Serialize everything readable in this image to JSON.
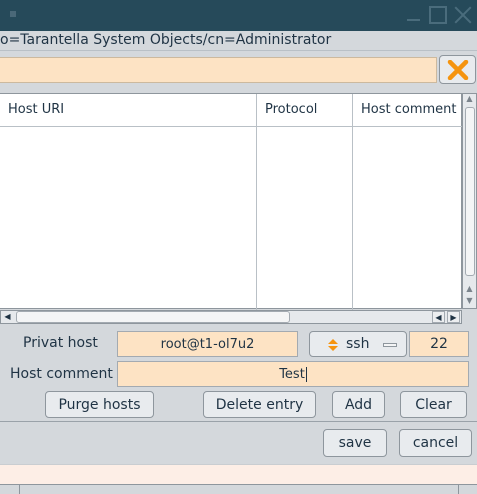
{
  "window": {
    "title": ""
  },
  "path": "o=Tarantella System Objects/cn=Administrator",
  "search": {
    "value": ""
  },
  "table": {
    "columns": [
      "Host URI",
      "Protocol",
      "Host comment"
    ],
    "rows": []
  },
  "form": {
    "privat_host_label": "Privat host",
    "privat_host_value": "root@t1-ol7u2",
    "protocol_value": "ssh",
    "port_value": "22",
    "host_comment_label": "Host comment",
    "host_comment_value": "Test"
  },
  "buttons": {
    "purge": "Purge hosts",
    "delete": "Delete entry",
    "add": "Add",
    "clear": "Clear",
    "save": "save",
    "cancel": "cancel"
  },
  "colors": {
    "titlebar": "#264a5a",
    "field_bg": "#fde3c4",
    "close_icon": "#f5940f"
  }
}
